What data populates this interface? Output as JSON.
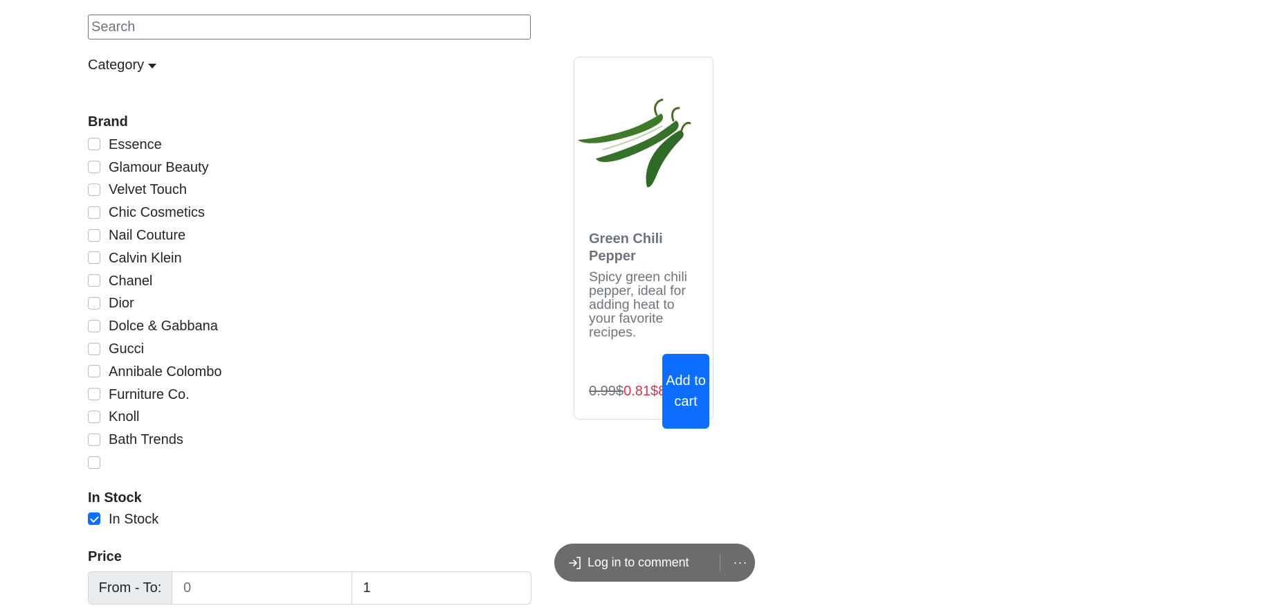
{
  "search": {
    "placeholder": "Search",
    "value": ""
  },
  "category": {
    "label": "Category"
  },
  "brand": {
    "title": "Brand",
    "items": [
      {
        "label": "Essence",
        "checked": false
      },
      {
        "label": "Glamour Beauty",
        "checked": false
      },
      {
        "label": "Velvet Touch",
        "checked": false
      },
      {
        "label": "Chic Cosmetics",
        "checked": false
      },
      {
        "label": "Nail Couture",
        "checked": false
      },
      {
        "label": "Calvin Klein",
        "checked": false
      },
      {
        "label": "Chanel",
        "checked": false
      },
      {
        "label": "Dior",
        "checked": false
      },
      {
        "label": "Dolce & Gabbana",
        "checked": false
      },
      {
        "label": "Gucci",
        "checked": false
      },
      {
        "label": "Annibale Colombo",
        "checked": false
      },
      {
        "label": "Furniture Co.",
        "checked": false
      },
      {
        "label": "Knoll",
        "checked": false
      },
      {
        "label": "Bath Trends",
        "checked": false
      },
      {
        "label": "",
        "checked": false
      }
    ]
  },
  "stock": {
    "title": "In Stock",
    "label": "In Stock",
    "checked": true
  },
  "price": {
    "title": "Price",
    "addon": "From - To:",
    "from_placeholder": "0",
    "from_value": "",
    "to_value": "1"
  },
  "product": {
    "image_icon": "green-chili-pepper-image",
    "title": "Green Chili Pepper",
    "description": "Spicy green chili pepper, ideal for adding heat to your favorite recipes.",
    "old_price": "0.99$",
    "new_price": "0.81$",
    "price_overflow": "8",
    "add_to_cart": "Add to cart"
  },
  "comment_bar": {
    "label": "Log in to comment",
    "icon": "login-icon",
    "more_icon": "more-icon",
    "more_text": "···"
  },
  "colors": {
    "accent": "#0d6efd",
    "sale": "#dc3545",
    "muted": "#6c757d",
    "bubble": "#6c6c6c"
  }
}
